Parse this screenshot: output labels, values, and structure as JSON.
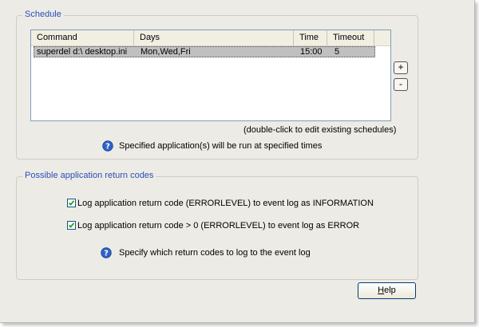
{
  "schedule": {
    "legend": "Schedule",
    "columns": [
      "Command",
      "Days",
      "Time",
      "Timeout"
    ],
    "rows": [
      {
        "command": "superdel d:\\ desktop.ini",
        "days": "Mon,Wed,Fri",
        "time": "15:00",
        "timeout": "5"
      }
    ],
    "add_label": "+",
    "remove_label": "-",
    "edit_hint": "(double-click to edit existing schedules)",
    "info_text": "Specified application(s) will be run at specified times"
  },
  "return_codes": {
    "legend": "Possible application return codes",
    "option1": {
      "label": "Log application return code (ERRORLEVEL) to event log as INFORMATION",
      "checked": true
    },
    "option2": {
      "label": "Log application return code > 0 (ERRORLEVEL) to event log as ERROR",
      "checked": true
    },
    "info_text": "Specify which return codes to log to the event log"
  },
  "help_button": {
    "label_first": "H",
    "label_rest": "elp"
  },
  "icons": [
    "help-question-icon",
    "checkmark-icon"
  ],
  "colors": {
    "legend_text": "#2a50b8",
    "selection": "#c0c0c0",
    "window_bg": "#ecebe5"
  }
}
